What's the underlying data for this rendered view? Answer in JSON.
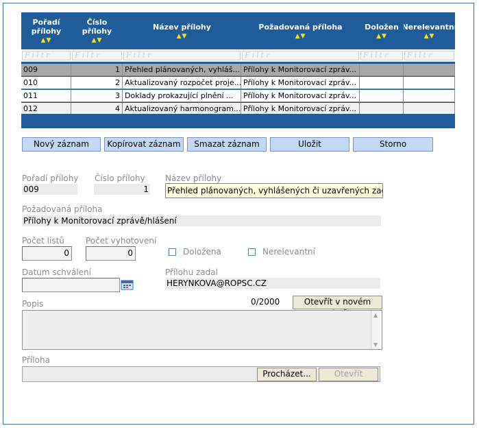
{
  "grid": {
    "headers": [
      {
        "label_line1": "Pořadí",
        "label_line2": "přílohy"
      },
      {
        "label_line1": "Číslo",
        "label_line2": "přílohy"
      },
      {
        "label_line1": "Název přílohy",
        "label_line2": ""
      },
      {
        "label_line1": "Požadovaná příloha",
        "label_line2": ""
      },
      {
        "label_line1": "Doložen",
        "label_line2": ""
      },
      {
        "label_line1": "Nerelevantní",
        "label_line2": ""
      }
    ],
    "sort_arrows": "▲▼",
    "filter_placeholder": "Filtr",
    "rows": [
      {
        "poradi": "009",
        "cislo": "1",
        "nazev": "Přehled plánovaných, vyhláš...",
        "pozadovana": "Přílohy k Monitorovací zpráv..."
      },
      {
        "poradi": "010",
        "cislo": "2",
        "nazev": "Aktualizovaný rozpočet proje...",
        "pozadovana": "Přílohy k Monitorovací zpráv..."
      },
      {
        "poradi": "011",
        "cislo": "3",
        "nazev": "Doklady prokazující plnění ...",
        "pozadovana": "Přílohy k Monitorovací zpráv..."
      },
      {
        "poradi": "012",
        "cislo": "4",
        "nazev": "Aktualizovaný harmonogram...",
        "pozadovana": "Přílohy k Monitorovací zpráv..."
      }
    ]
  },
  "toolbar": {
    "new_label": "Nový záznam",
    "copy_label": "Kopírovat záznam",
    "delete_label": "Smazat záznam",
    "save_label": "Uložit",
    "cancel_label": "Storno"
  },
  "form": {
    "poradi_label": "Pořadí přílohy",
    "poradi_value": "009",
    "cislo_label": "Číslo přílohy",
    "cislo_value": "1",
    "nazev_label": "Název přílohy",
    "nazev_value": "Přehled plánovaných, vyhlášených či uzavřených zadá",
    "pozadovana_label": "Požadovaná příloha",
    "pozadovana_value": "Přílohy k Monitorovací zprávě/hlášení",
    "pocet_listu_label": "Počet listů",
    "pocet_listu_value": "0",
    "pocet_vyhotoveni_label": "Počet vyhotovení",
    "pocet_vyhotoveni_value": "0",
    "dolozena_label": "Doložena",
    "nerelevantni_label": "Nerelevantní",
    "datum_label": "Datum schválení",
    "datum_value": "",
    "zadal_label": "Přílohu zadal",
    "zadal_value": "HERYNKOVA@ROPSC.CZ",
    "popis_label": "Popis",
    "popis_counter": "0/2000",
    "open_window_label": "Otevřít v novém okně",
    "priloha_label": "Příloha",
    "browse_label": "Procházet...",
    "open_label": "Otevřít"
  },
  "colors": {
    "grid_header": "#1f5c99",
    "button_bg": "#c6d7f3",
    "highlight_field": "#ffffe1"
  }
}
